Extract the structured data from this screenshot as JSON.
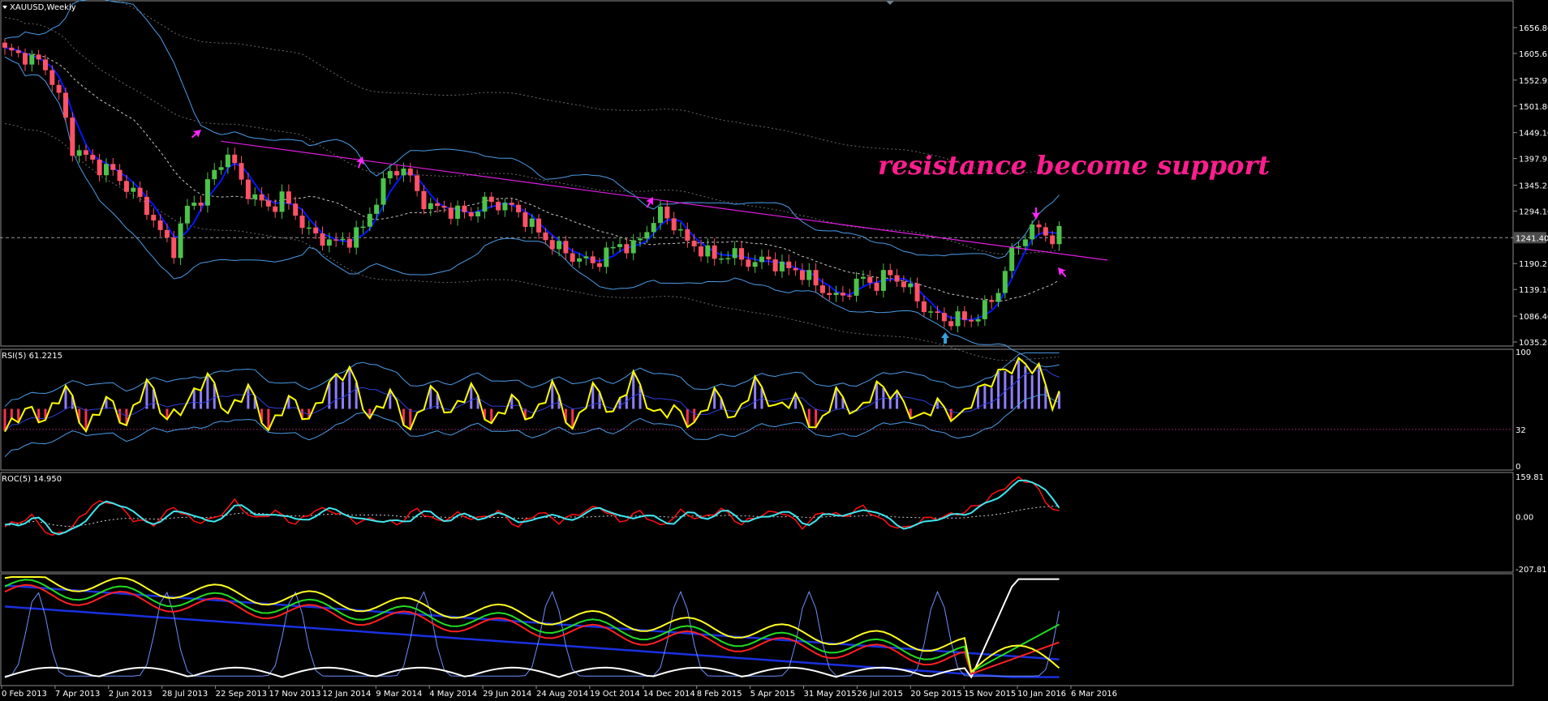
{
  "window": {
    "title": "XAUUSD,Weekly",
    "menu_icon": "triangle-down-icon",
    "scroll_marker_icon": "triangle-down-icon"
  },
  "colors": {
    "background": "#000000",
    "bull_candle": "#4cc34a",
    "bear_candle": "#ff5266",
    "bollinger": "#4a9ce8",
    "ma_fast": "#0018ff",
    "ma_slow_dotted": "#c8c8c8",
    "trendline": "#e11de1",
    "arrow_markers": "#ff26ff",
    "annotation": "#ff1d8f",
    "rsi_line": "#ffff00",
    "rsi_hist_pos": "#8e7cff",
    "rsi_hist_neg": "#ff3050",
    "roc_red": "#ff1010",
    "roc_cyan": "#3ee7f0",
    "panel_border": "#8c8c8c"
  },
  "annotation": "resistance become support",
  "price_axis": {
    "labels": [
      "1656.80",
      "1605.65",
      "1552.95",
      "1501.80",
      "1449.10",
      "1397.95",
      "1345.25",
      "1294.10",
      "1241.40",
      "1190.25",
      "1139.10",
      "1086.40",
      "1035.25"
    ],
    "current_price": "1241.40",
    "ylim": [
      1035.25,
      1656.8
    ]
  },
  "time_axis": [
    "0 Feb 2013",
    "7 Apr 2013",
    "2 Jun 2013",
    "28 Jul 2013",
    "22 Sep 2013",
    "17 Nov 2013",
    "12 Jan 2014",
    "9 Mar 2014",
    "4 May 2014",
    "29 Jun 2014",
    "24 Aug 2014",
    "19 Oct 2014",
    "14 Dec 2014",
    "8 Feb 2015",
    "5 Apr 2015",
    "31 May 2015",
    "26 Jul 2015",
    "20 Sep 2015",
    "15 Nov 2015",
    "10 Jan 2016",
    "6 Mar 2016"
  ],
  "rsi_panel": {
    "label": "RSI(5) 61.2215",
    "axis_labels": [
      "100",
      "32",
      "0"
    ],
    "level": 32
  },
  "roc_panel": {
    "label": "ROC(5) 14.950",
    "axis_labels": [
      "159.81",
      "0.00",
      "-207.81"
    ]
  },
  "chart_data": [
    {
      "type": "candlestick",
      "symbol": "XAUUSD",
      "timeframe": "Weekly",
      "ylim": [
        1035.25,
        1656.8
      ],
      "anchors": [
        [
          0,
          1610
        ],
        [
          3,
          1600
        ],
        [
          6,
          1580
        ],
        [
          8,
          1520
        ],
        [
          10,
          1420
        ],
        [
          13,
          1390
        ],
        [
          16,
          1370
        ],
        [
          19,
          1330
        ],
        [
          21,
          1300
        ],
        [
          23,
          1250
        ],
        [
          25,
          1220
        ],
        [
          27,
          1300
        ],
        [
          29,
          1320
        ],
        [
          31,
          1370
        ],
        [
          33,
          1410
        ],
        [
          35,
          1350
        ],
        [
          37,
          1320
        ],
        [
          39,
          1300
        ],
        [
          41,
          1320
        ],
        [
          43,
          1290
        ],
        [
          45,
          1250
        ],
        [
          47,
          1240
        ],
        [
          49,
          1230
        ],
        [
          51,
          1240
        ],
        [
          53,
          1260
        ],
        [
          55,
          1320
        ],
        [
          57,
          1370
        ],
        [
          59,
          1380
        ],
        [
          61,
          1330
        ],
        [
          63,
          1300
        ],
        [
          65,
          1300
        ],
        [
          67,
          1290
        ],
        [
          69,
          1290
        ],
        [
          71,
          1310
        ],
        [
          73,
          1310
        ],
        [
          75,
          1300
        ],
        [
          77,
          1280
        ],
        [
          79,
          1250
        ],
        [
          81,
          1230
        ],
        [
          83,
          1210
        ],
        [
          85,
          1200
        ],
        [
          87,
          1190
        ],
        [
          89,
          1210
        ],
        [
          91,
          1230
        ],
        [
          93,
          1220
        ],
        [
          95,
          1260
        ],
        [
          97,
          1290
        ],
        [
          99,
          1270
        ],
        [
          101,
          1230
        ],
        [
          103,
          1220
        ],
        [
          105,
          1200
        ],
        [
          107,
          1210
        ],
        [
          109,
          1200
        ],
        [
          111,
          1190
        ],
        [
          113,
          1200
        ],
        [
          115,
          1180
        ],
        [
          117,
          1180
        ],
        [
          119,
          1160
        ],
        [
          121,
          1140
        ],
        [
          123,
          1120
        ],
        [
          125,
          1140
        ],
        [
          127,
          1160
        ],
        [
          129,
          1150
        ],
        [
          131,
          1170
        ],
        [
          133,
          1150
        ],
        [
          135,
          1120
        ],
        [
          137,
          1090
        ],
        [
          139,
          1080
        ],
        [
          141,
          1080
        ],
        [
          143,
          1080
        ],
        [
          145,
          1100
        ],
        [
          147,
          1140
        ],
        [
          149,
          1210
        ],
        [
          151,
          1250
        ],
        [
          153,
          1260
        ],
        [
          155,
          1240
        ],
        [
          156,
          1246
        ]
      ]
    },
    {
      "type": "line",
      "title": "RSI(5) 61.2215",
      "ylim": [
        0,
        100
      ],
      "anchors": [
        [
          0,
          30
        ],
        [
          3,
          50
        ],
        [
          6,
          40
        ],
        [
          9,
          70
        ],
        [
          12,
          30
        ],
        [
          15,
          60
        ],
        [
          18,
          35
        ],
        [
          21,
          75
        ],
        [
          24,
          40
        ],
        [
          27,
          55
        ],
        [
          30,
          80
        ],
        [
          33,
          45
        ],
        [
          36,
          70
        ],
        [
          39,
          30
        ],
        [
          42,
          60
        ],
        [
          45,
          40
        ],
        [
          48,
          72
        ],
        [
          51,
          85
        ],
        [
          54,
          40
        ],
        [
          57,
          65
        ],
        [
          60,
          30
        ],
        [
          63,
          68
        ],
        [
          66,
          45
        ],
        [
          69,
          70
        ],
        [
          72,
          35
        ],
        [
          75,
          60
        ],
        [
          78,
          40
        ],
        [
          81,
          72
        ],
        [
          84,
          30
        ],
        [
          87,
          70
        ],
        [
          90,
          45
        ],
        [
          93,
          80
        ],
        [
          96,
          45
        ],
        [
          99,
          50
        ],
        [
          102,
          35
        ],
        [
          105,
          65
        ],
        [
          108,
          40
        ],
        [
          111,
          75
        ],
        [
          114,
          50
        ],
        [
          117,
          60
        ],
        [
          120,
          30
        ],
        [
          123,
          65
        ],
        [
          126,
          45
        ],
        [
          129,
          70
        ],
        [
          132,
          62
        ],
        [
          135,
          40
        ],
        [
          138,
          55
        ],
        [
          141,
          40
        ],
        [
          144,
          65
        ],
        [
          147,
          80
        ],
        [
          150,
          90
        ],
        [
          153,
          85
        ],
        [
          155,
          55
        ],
        [
          156,
          61
        ]
      ]
    },
    {
      "type": "line",
      "title": "ROC(5) 14.950",
      "ylim": [
        -207.81,
        159.81
      ],
      "anchors": [
        [
          0,
          -40
        ],
        [
          4,
          0
        ],
        [
          7,
          -80
        ],
        [
          10,
          -40
        ],
        [
          13,
          50
        ],
        [
          16,
          60
        ],
        [
          19,
          -10
        ],
        [
          22,
          -30
        ],
        [
          25,
          40
        ],
        [
          28,
          -20
        ],
        [
          31,
          -10
        ],
        [
          34,
          60
        ],
        [
          37,
          -10
        ],
        [
          40,
          20
        ],
        [
          43,
          -30
        ],
        [
          46,
          30
        ],
        [
          49,
          20
        ],
        [
          52,
          -20
        ],
        [
          55,
          -10
        ],
        [
          58,
          -30
        ],
        [
          61,
          30
        ],
        [
          64,
          -20
        ],
        [
          67,
          10
        ],
        [
          70,
          -10
        ],
        [
          73,
          20
        ],
        [
          76,
          -40
        ],
        [
          79,
          20
        ],
        [
          82,
          -20
        ],
        [
          85,
          15
        ],
        [
          88,
          40
        ],
        [
          91,
          -20
        ],
        [
          94,
          20
        ],
        [
          97,
          -40
        ],
        [
          100,
          20
        ],
        [
          103,
          -10
        ],
        [
          106,
          30
        ],
        [
          109,
          -30
        ],
        [
          112,
          10
        ],
        [
          115,
          20
        ],
        [
          118,
          -40
        ],
        [
          121,
          20
        ],
        [
          124,
          0
        ],
        [
          127,
          40
        ],
        [
          130,
          -20
        ],
        [
          133,
          -50
        ],
        [
          136,
          -10
        ],
        [
          139,
          0
        ],
        [
          142,
          20
        ],
        [
          145,
          60
        ],
        [
          148,
          120
        ],
        [
          150,
          150
        ],
        [
          152,
          140
        ],
        [
          154,
          60
        ],
        [
          156,
          15
        ]
      ]
    }
  ]
}
